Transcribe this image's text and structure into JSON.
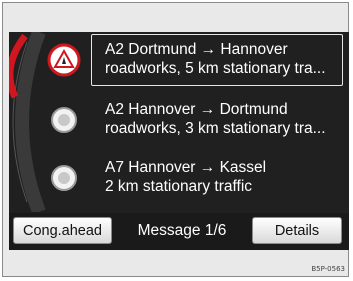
{
  "messages": [
    {
      "route": "A2 Dortmund → Hannover",
      "detail": "roadworks, 5 km stationary tra...",
      "icon": "roadworks-warning-icon",
      "selected": true
    },
    {
      "route": "A2 Hannover → Dortmund",
      "detail": "roadworks, 3 km stationary tra...",
      "icon": "traffic-info-icon",
      "selected": false
    },
    {
      "route": "A7 Hannover → Kassel",
      "detail": "2 km stationary traffic",
      "icon": "traffic-info-icon",
      "selected": false
    }
  ],
  "bottom_bar": {
    "left_button": "Cong.ahead",
    "counter": "Message 1/6",
    "right_button": "Details"
  },
  "reference_code": "B5P-0563",
  "colors": {
    "screen_bg": "#202020",
    "accent_red": "#d0171f",
    "text": "#ffffff"
  }
}
